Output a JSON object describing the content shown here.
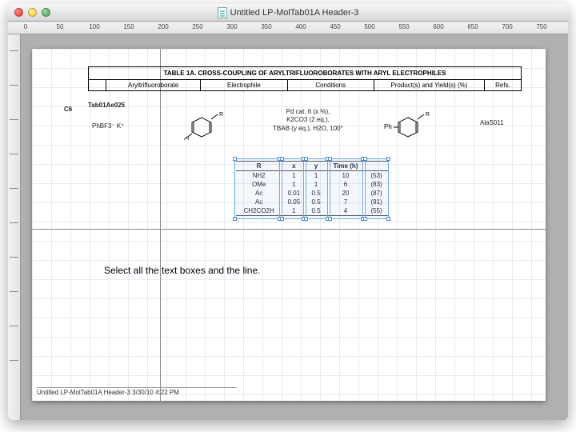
{
  "window": {
    "title": "Untitled LP-MolTab01A Header-3"
  },
  "ruler": {
    "hticks": [
      "0",
      "50",
      "100",
      "150",
      "200",
      "250",
      "300",
      "350",
      "400",
      "450",
      "500",
      "550",
      "600",
      "650",
      "700",
      "750"
    ]
  },
  "table": {
    "title": "TABLE 1A. CROSS-COUPLING OF ARYLTRIFLUOROBORATES WITH ARYL ELECTROPHILES",
    "headers": {
      "c1": "",
      "c2": "Aryltrifluoroborate",
      "c3": "Electrophile",
      "c4": "Conditions",
      "c5": "Product(s) and Yield(s) (%)",
      "c6": "Refs."
    }
  },
  "entry": {
    "label": "C6",
    "tag": "Tab01Ae025",
    "borate": "PhBF3⁻ K⁺",
    "electrophile_sub": "R",
    "conditions_l1": "Pd cat. 6 (x %),",
    "conditions_l2": "K2CO3 (2 eq.),",
    "conditions_l3": "TBAB (y eq.), H2O, 100°",
    "product_prefix": "Ph",
    "product_sub": "R",
    "ref": "AlaS011"
  },
  "subtable": {
    "headers": [
      "R",
      "x",
      "y",
      "Time (h)",
      ""
    ],
    "rows": [
      [
        "NH2",
        "1",
        "1",
        "10",
        "(53)"
      ],
      [
        "OMe",
        "1",
        "1",
        "6",
        "(83)"
      ],
      [
        "Ac",
        "0.01",
        "0.5",
        "20",
        "(87)"
      ],
      [
        "Ac",
        "0.05",
        "0.5",
        "7",
        "(91)"
      ],
      [
        "CH2CO2H",
        "1",
        "0.5",
        "4",
        "(55)"
      ]
    ]
  },
  "instruction": "Select all the text boxes and the line.",
  "footer": "Untitled LP-MolTab01A Header-3 3/30/10 4:22 PM"
}
